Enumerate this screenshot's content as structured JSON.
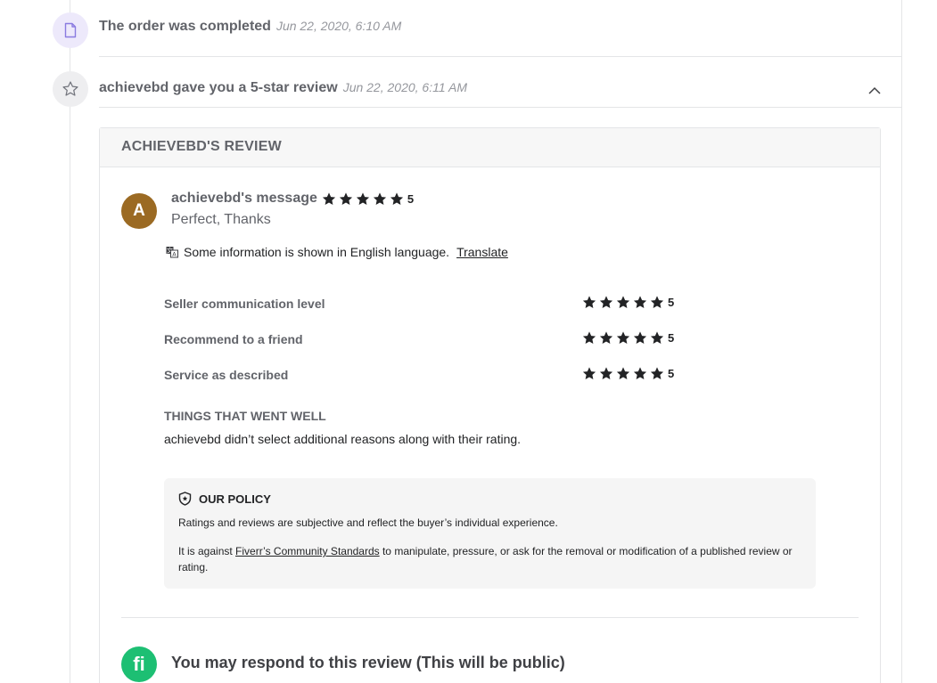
{
  "timeline": {
    "events": [
      {
        "title": "The order was completed",
        "date": "Jun 22, 2020, 6:10 AM",
        "icon": "document-icon"
      },
      {
        "title": "achievebd gave you a 5-star review",
        "date": "Jun 22, 2020, 6:11 AM",
        "icon": "star-outline-icon"
      }
    ]
  },
  "review": {
    "header": "ACHIEVEBD'S REVIEW",
    "avatar_letter": "A",
    "avatar_color": "#9b6a23",
    "message_title": "achievebd's message",
    "message_rating": "5",
    "message_text": "Perfect, Thanks",
    "translate_notice": "Some information is shown in English language.",
    "translate_link": "Translate",
    "ratings": [
      {
        "label": "Seller communication level",
        "value": "5"
      },
      {
        "label": "Recommend to a friend",
        "value": "5"
      },
      {
        "label": "Service as described",
        "value": "5"
      }
    ],
    "went_well_title": "THINGS THAT WENT WELL",
    "went_well_text": "achievebd didn’t select additional reasons along with their rating.",
    "policy": {
      "title": "OUR POLICY",
      "p1": "Ratings and reviews are subjective and reflect the buyer’s individual experience.",
      "p2_before": "It is against ",
      "p2_link": "Fiverr’s Community Standards",
      "p2_after": " to manipulate, pressure, or ask for the removal or modification of a published review or rating."
    },
    "respond_logo": "fi",
    "respond_title": "You may respond to this review (This will be public)"
  },
  "colors": {
    "brand_green": "#1dbf73",
    "star": "#222325"
  }
}
